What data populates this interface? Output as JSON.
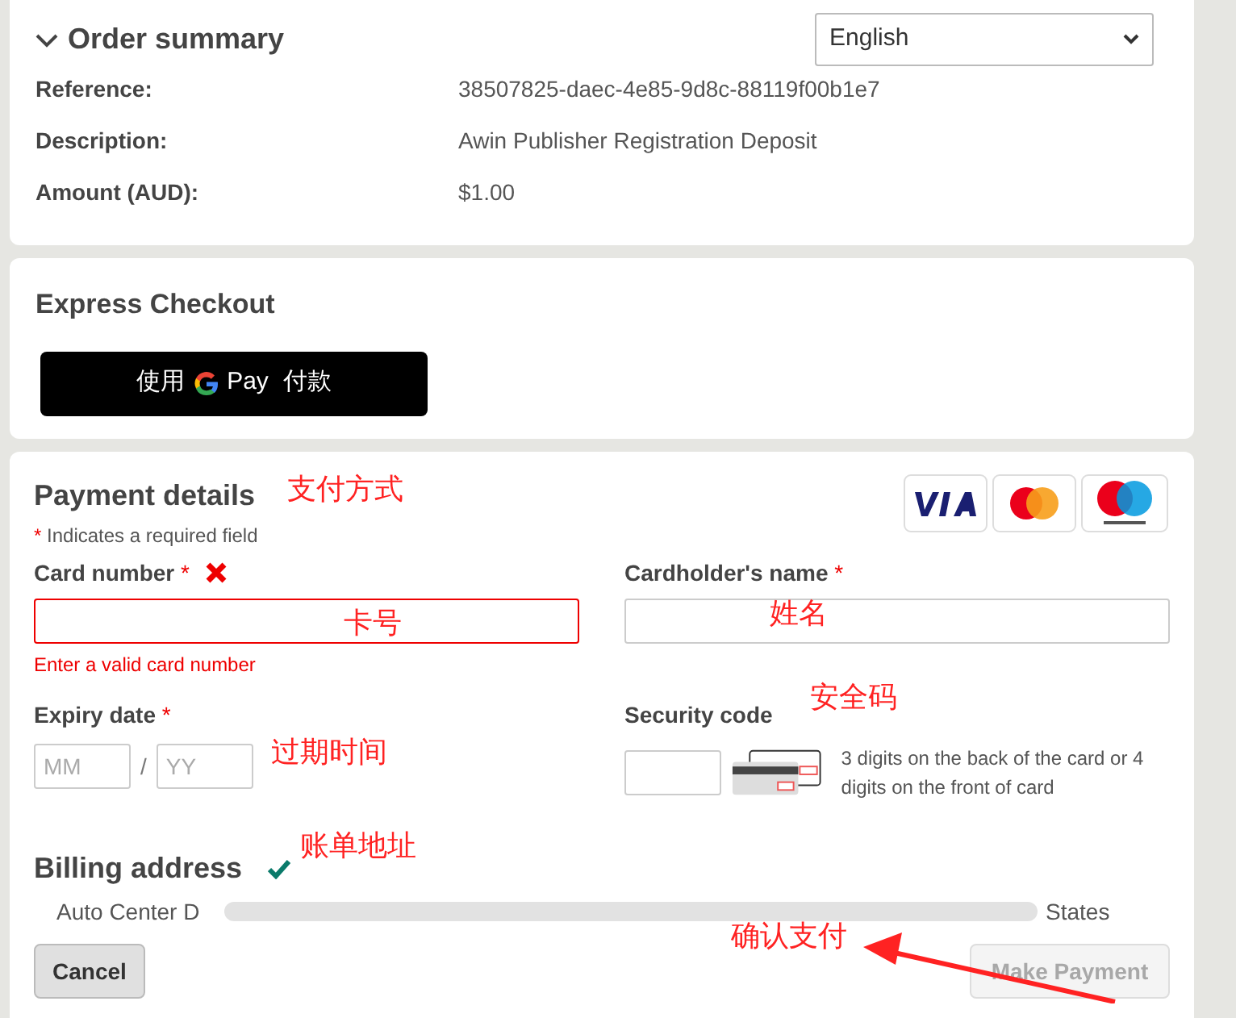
{
  "order_summary": {
    "title": "Order summary",
    "expanded": true,
    "language": "English",
    "rows": [
      {
        "label": "Reference:",
        "value": "38507825-daec-4e85-9d8c-88119f00b1e7"
      },
      {
        "label": "Description:",
        "value": "Awin Publisher Registration Deposit"
      },
      {
        "label": "Amount (AUD):",
        "value": "$1.00"
      }
    ]
  },
  "express_checkout": {
    "title": "Express Checkout",
    "button": {
      "before": "使用",
      "brand": "Pay",
      "after": "付款"
    }
  },
  "payment_details": {
    "title": "Payment details",
    "required_mark": "*",
    "required_note": "Indicates a required field",
    "card_number": {
      "label": "Card number",
      "required": true,
      "invalid": true,
      "error": "Enter a valid card number"
    },
    "cardholder_name": {
      "label": "Cardholder's name",
      "required": true
    },
    "expiry": {
      "label": "Expiry date",
      "required": true,
      "month_placeholder": "MM",
      "separator": "/",
      "year_placeholder": "YY"
    },
    "security_code": {
      "label": "Security code",
      "hint": "3 digits on the back of the card or 4 digits on the front of card"
    },
    "billing": {
      "title": "Billing address",
      "verified": true,
      "address_start": "Auto Center D",
      "address_end": "States"
    },
    "cancel": "Cancel",
    "make_payment": {
      "label": "Make Payment",
      "disabled": true
    }
  },
  "annotations": [
    {
      "text": "支付方式"
    },
    {
      "text": "卡号"
    },
    {
      "text": "姓名"
    },
    {
      "text": "安全码"
    },
    {
      "text": "过期时间"
    },
    {
      "text": "账单地址"
    },
    {
      "text": "确认支付"
    }
  ]
}
